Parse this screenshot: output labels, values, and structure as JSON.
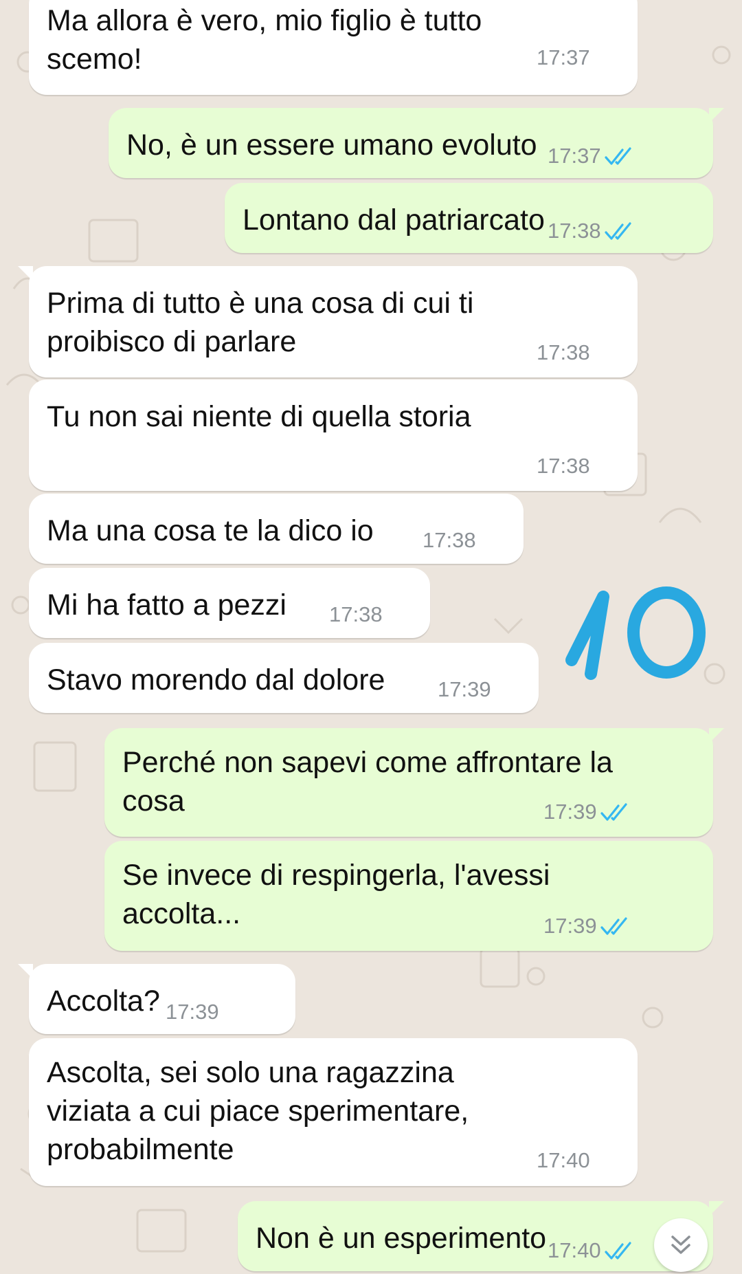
{
  "messages": [
    {
      "dir": "in",
      "text": "Ma allora è vero, mio figlio è tutto\nscemo!",
      "time": "17:37"
    },
    {
      "dir": "out",
      "text": "No, è un essere umano evoluto",
      "time": "17:37",
      "status": "read"
    },
    {
      "dir": "out",
      "text": "Lontano dal patriarcato",
      "time": "17:38",
      "status": "read"
    },
    {
      "dir": "in",
      "text": "Prima di tutto è una cosa di cui ti\nproibisco di parlare",
      "time": "17:38"
    },
    {
      "dir": "in",
      "text": "Tu non sai niente di quella storia",
      "time": "17:38"
    },
    {
      "dir": "in",
      "text": "Ma una cosa te la dico io",
      "time": "17:38"
    },
    {
      "dir": "in",
      "text": "Mi ha fatto a pezzi",
      "time": "17:38"
    },
    {
      "dir": "in",
      "text": "Stavo morendo dal dolore",
      "time": "17:39"
    },
    {
      "dir": "out",
      "text": "Perché non sapevi come affrontare la\ncosa",
      "time": "17:39",
      "status": "read"
    },
    {
      "dir": "out",
      "text": "Se invece di respingerla, l'avessi\naccolta...",
      "time": "17:39",
      "status": "read"
    },
    {
      "dir": "in",
      "text": "Accolta?",
      "time": "17:39"
    },
    {
      "dir": "in",
      "text": "Ascolta, sei solo una ragazzina\nviziata a cui piace sperimentare,\nprobabilmente",
      "time": "17:40"
    },
    {
      "dir": "out",
      "text": "Non è un esperimento",
      "time": "17:40",
      "status": "read"
    }
  ],
  "annotation": {
    "text": "10",
    "color": "#29a8e0"
  },
  "colors": {
    "background": "#ece5dd",
    "incoming_bubble": "#ffffff",
    "outgoing_bubble": "#e7fdd4",
    "read_ticks": "#34b7f1",
    "timestamp": "#8c9196"
  },
  "icons": {
    "read_status": "double-check-icon",
    "scroll_down": "double-chevron-down-icon"
  }
}
